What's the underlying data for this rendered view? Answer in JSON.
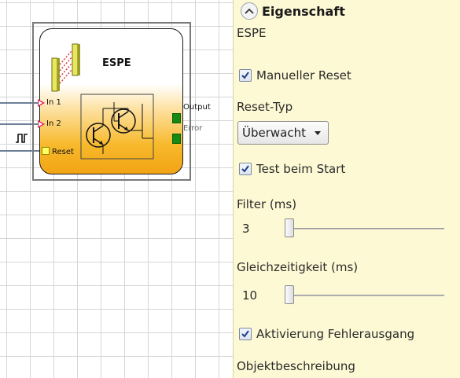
{
  "block": {
    "title": "ESPE",
    "inputs": [
      "In 1",
      "In 2"
    ],
    "reset_label": "Reset",
    "outputs": [
      "Output",
      "Error"
    ]
  },
  "panel": {
    "header": "Eigenschaft",
    "block_type": "ESPE",
    "manual_reset": {
      "label": "Manueller Reset",
      "checked": true
    },
    "reset_type": {
      "label": "Reset-Typ",
      "selected": "Überwacht"
    },
    "test_at_start": {
      "label": "Test beim Start",
      "checked": true
    },
    "filter": {
      "label": "Filter (ms)",
      "value": "3"
    },
    "simultaneity": {
      "label": "Gleichzeitigkeit (ms)",
      "value": "10"
    },
    "enable_error_output": {
      "label": "Aktivierung Fehlerausgang",
      "checked": true
    },
    "object_description_label": "Objektbeschreibung"
  },
  "colors": {
    "panel_bg": "#fcf9d4",
    "block_gradient_bottom": "#f2a414",
    "input_arrow": "#e0245e",
    "output_port": "#138a13",
    "reset_port": "#ffff66"
  },
  "icons": [
    "light-curtain-icon",
    "phototransistor-icon",
    "pulse-signal-icon",
    "chevron-up-icon",
    "checkmark-icon",
    "dropdown-caret-icon"
  ]
}
